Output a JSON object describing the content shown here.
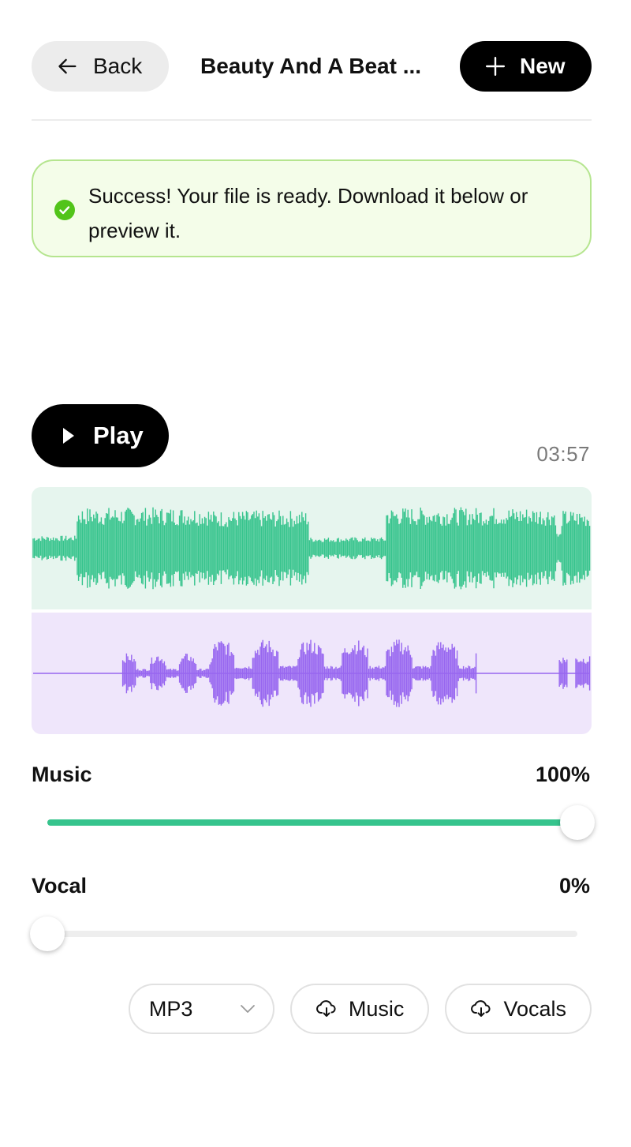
{
  "header": {
    "back_label": "Back",
    "title": "Beauty And A Beat ...",
    "new_label": "New"
  },
  "alert": {
    "text": "Success! Your file is ready. Download it below or preview it.",
    "color": "#b5e58f"
  },
  "player": {
    "play_label": "Play",
    "duration": "03:57",
    "music_color": "#36c48d",
    "vocal_color": "#9766f0"
  },
  "sliders": {
    "music": {
      "label": "Music",
      "value_text": "100%",
      "level": 1.0
    },
    "vocal": {
      "label": "Vocal",
      "value_text": "0%",
      "level": 0.0
    }
  },
  "downloads": {
    "format_value": "MP3",
    "music_label": "Music",
    "vocals_label": "Vocals"
  }
}
